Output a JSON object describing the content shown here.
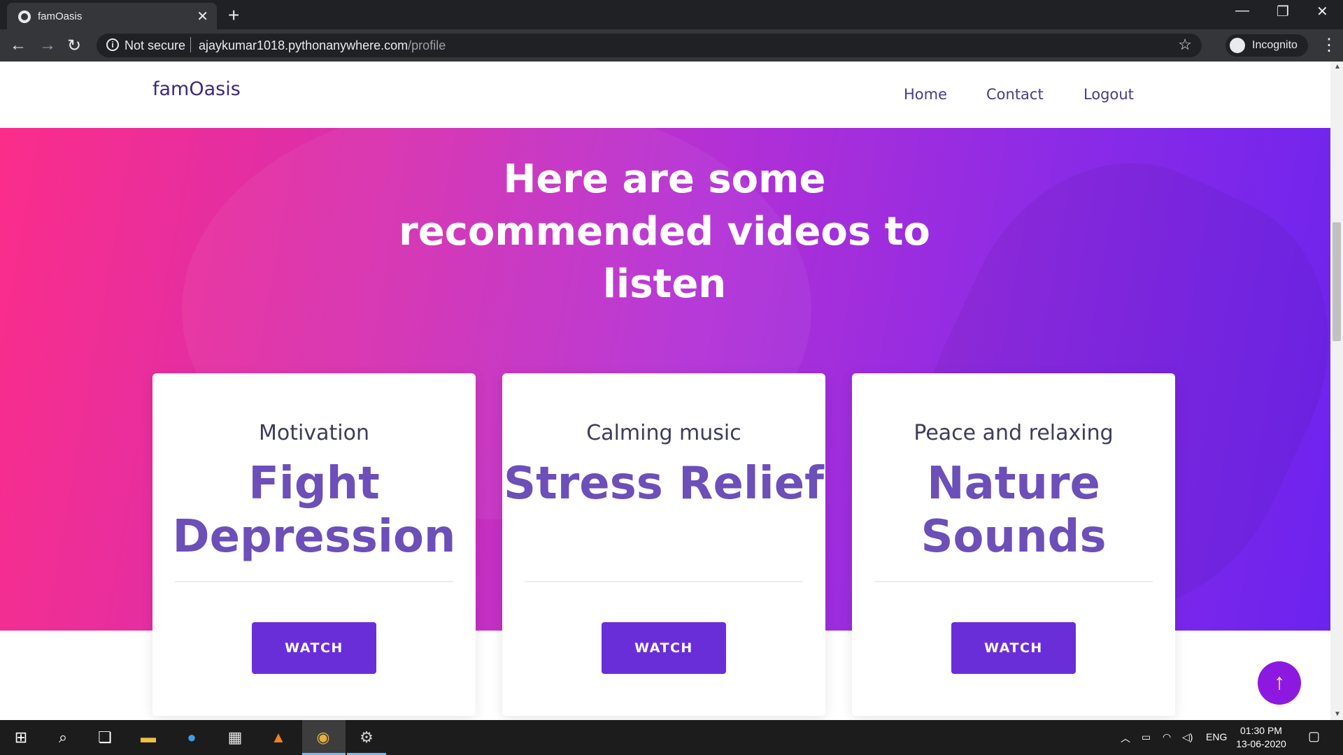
{
  "browser": {
    "tab_title": "famOasis",
    "tab_close": "✕",
    "new_tab": "+",
    "security": "Not secure",
    "url_host": "ajaykumar1018.pythonanywhere.com",
    "url_path": "/profile",
    "profile_label": "Incognito"
  },
  "site": {
    "brand": "famOasis",
    "nav": [
      "Home",
      "Contact",
      "Logout"
    ],
    "hero_title": "Here are some recommended videos to listen",
    "cards": [
      {
        "subtitle": "Motivation",
        "heading": "Fight Depression",
        "button": "WATCH"
      },
      {
        "subtitle": "Calming music",
        "heading": "Stress Relief",
        "button": "WATCH"
      },
      {
        "subtitle": "Peace and relaxing",
        "heading": "Nature Sounds",
        "button": "WATCH"
      }
    ]
  },
  "taskbar": {
    "lang": "ENG",
    "time": "01:30 PM",
    "date": "13-06-2020"
  },
  "colors": {
    "accent": "#6a2ed8",
    "heading": "#6c4fb8",
    "hero_start": "#fb2d8a",
    "hero_end": "#6c23ee"
  }
}
